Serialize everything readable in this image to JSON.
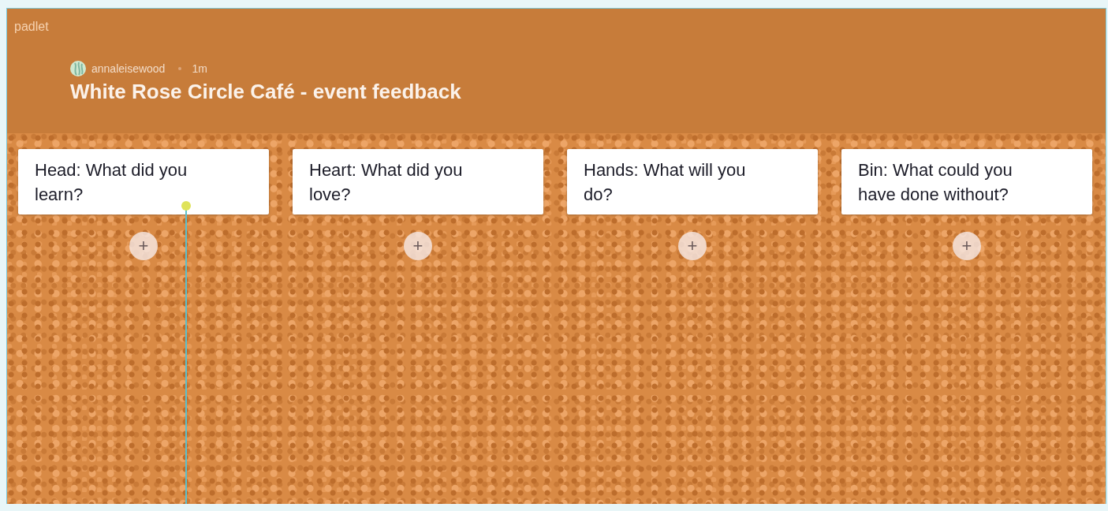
{
  "app": {
    "logo": "padlet"
  },
  "board": {
    "author": "annaleisewood",
    "time": "1m",
    "title": "White Rose Circle Café - event feedback"
  },
  "columns": [
    {
      "title": "Head: What did you learn?",
      "add": "+"
    },
    {
      "title": "Heart: What did you love?",
      "add": "+"
    },
    {
      "title": "Hands: What will you do?",
      "add": "+"
    },
    {
      "title": "Bin: What could you have done without?",
      "add": "+"
    }
  ]
}
